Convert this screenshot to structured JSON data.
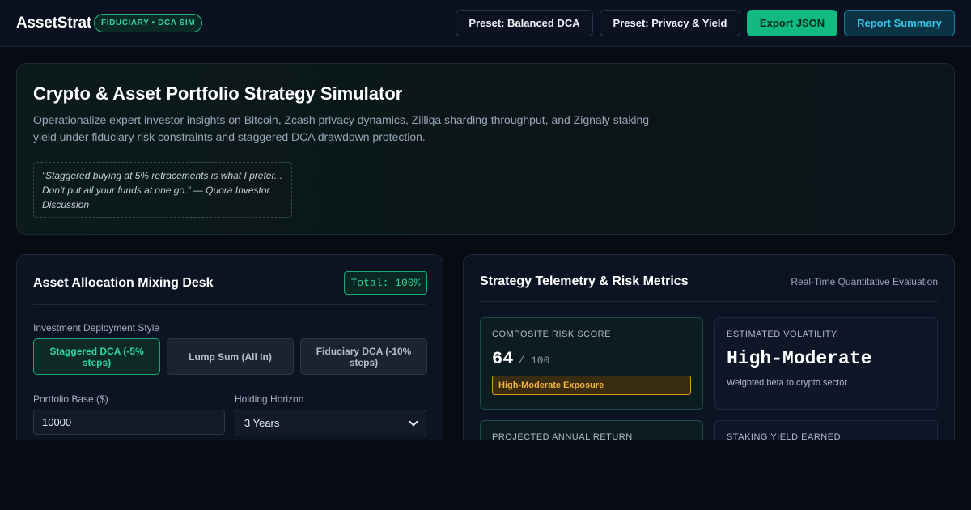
{
  "header": {
    "brand": "AssetStrat",
    "badge": "FIDUCIARY • DCA SIM",
    "buttons": {
      "preset_balanced": "Preset: Balanced DCA",
      "preset_privacy": "Preset: Privacy & Yield",
      "export": "Export JSON",
      "report": "Report Summary"
    }
  },
  "hero": {
    "title": "Crypto & Asset Portfolio Strategy Simulator",
    "description": "Operationalize expert investor insights on Bitcoin, Zcash privacy dynamics, Zilliqa sharding throughput, and Zignaly staking yield under fiduciary risk constraints and staggered DCA drawdown protection.",
    "quote": "“Staggered buying at 5% retracements is what I prefer... Don’t put all your funds at one go.” — Quora Investor Discussion"
  },
  "allocation": {
    "title": "Asset Allocation Mixing Desk",
    "total": "Total: 100%",
    "deployment_label": "Investment Deployment Style",
    "styles": [
      "Staggered DCA (-5% steps)",
      "Lump Sum (All In)",
      "Fiduciary DCA (-10% steps)"
    ],
    "portfolio_label": "Portfolio Base ($)",
    "portfolio_value": "10000",
    "horizon_label": "Holding Horizon",
    "horizon_value": "3 Years"
  },
  "telemetry": {
    "title": "Strategy Telemetry & Risk Metrics",
    "subtitle": "Real-Time Quantitative Evaluation",
    "risk": {
      "label": "Composite Risk Score",
      "value": "64",
      "max": "/ 100",
      "exposure": "High-Moderate Exposure"
    },
    "volatility": {
      "label": "Estimated Volatility",
      "value": "High-Moderate",
      "note": "Weighted beta to crypto sector"
    },
    "return_label": "Projected Annual Return",
    "staking_label": "Staking Yield Earned"
  },
  "colors": {
    "accent_green": "#12b981",
    "accent_cyan": "#34c6e8",
    "warning": "#f5b43a",
    "background": "#070b12"
  }
}
